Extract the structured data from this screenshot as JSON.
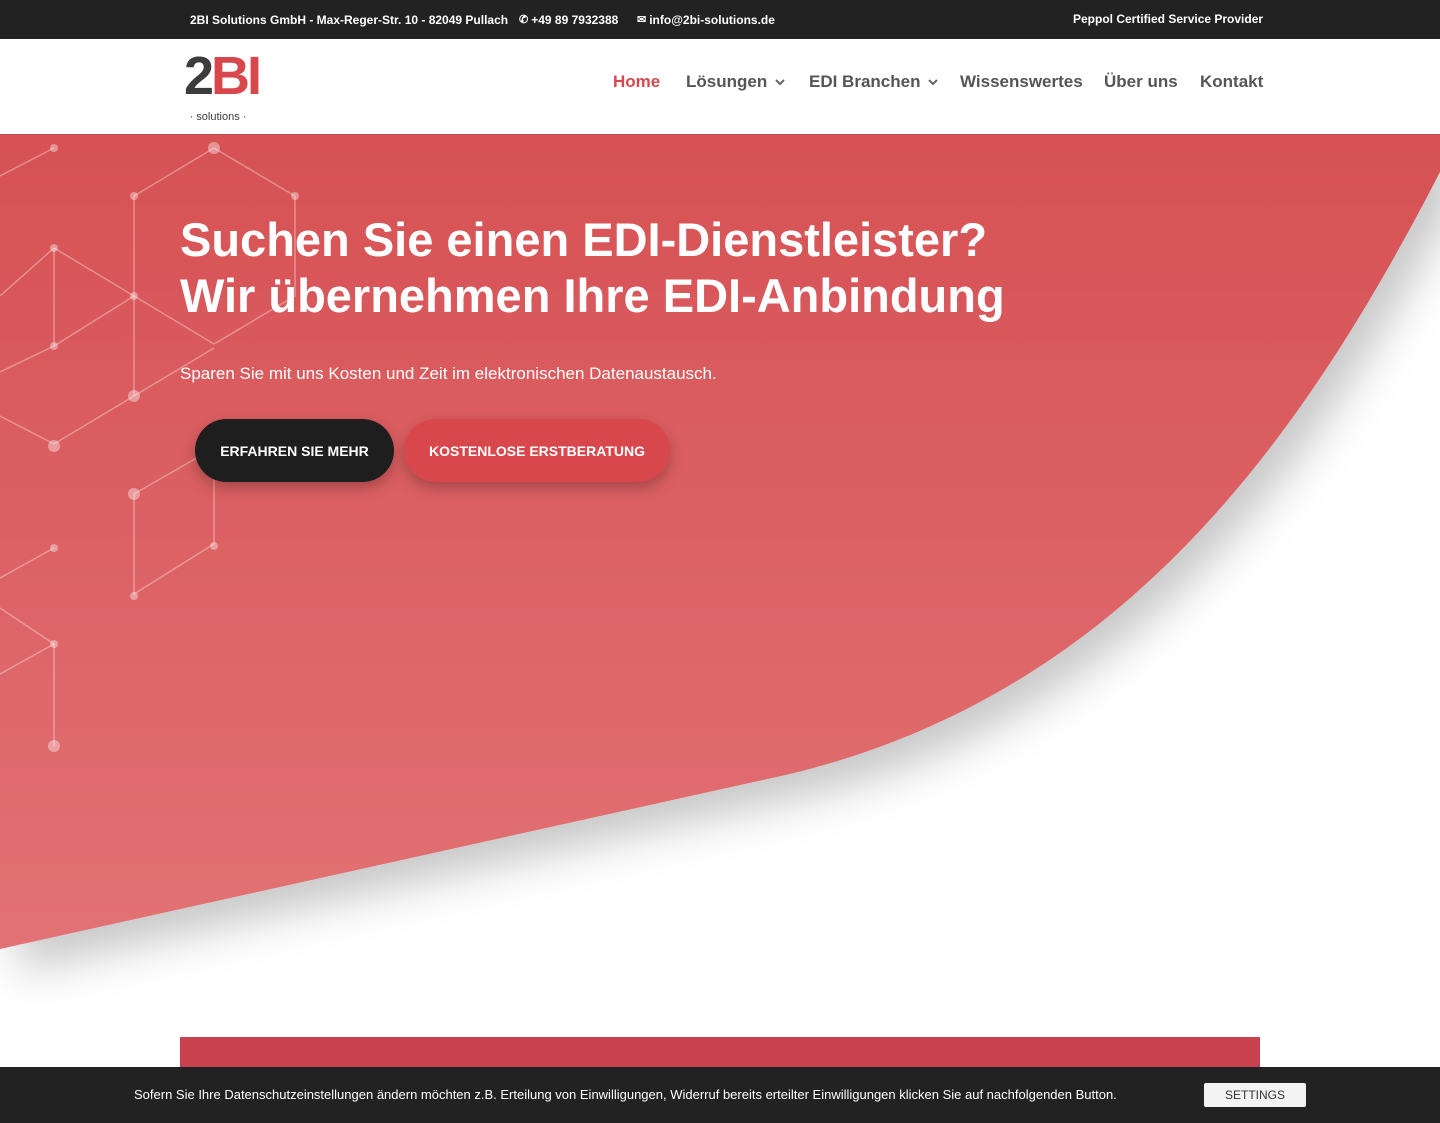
{
  "topbar": {
    "company": "2BI Solutions GmbH - Max-Reger-Str. 10 - 82049 Pullach",
    "phone": "+49 89 7932388",
    "email": "info@2bi-solutions.de",
    "peppol": "Peppol Certified Service Provider"
  },
  "logo": {
    "mark_two": "2",
    "mark_bi": "BI",
    "sub": "· solutions ·"
  },
  "nav": {
    "items": [
      {
        "label": "Home",
        "active": true,
        "has_dropdown": false
      },
      {
        "label": "Lösungen",
        "active": false,
        "has_dropdown": true
      },
      {
        "label": "EDI Branchen",
        "active": false,
        "has_dropdown": true
      },
      {
        "label": "Wissenswertes",
        "active": false,
        "has_dropdown": false
      },
      {
        "label": "Über uns",
        "active": false,
        "has_dropdown": false
      },
      {
        "label": "Kontakt",
        "active": false,
        "has_dropdown": false
      }
    ],
    "chevron_icon": "chevron-down-icon"
  },
  "hero": {
    "title_line1": "Suchen Sie einen EDI-Dienstleister?",
    "title_line2": "Wir übernehmen Ihre EDI-Anbindung",
    "lead": "Sparen Sie mit uns Kosten und Zeit im elektronischen Datenaustausch.",
    "btn_more": "Erfahren Sie mehr",
    "btn_consult": "Kostenlose Erstberatung"
  },
  "cookie": {
    "text": "Sofern Sie Ihre Datenschutzeinstellungen ändern möchten z.B. Erteilung von Einwilligungen, Widerruf bereits erteilter Einwilligungen klicken Sie auf nachfolgenden Button.",
    "button": "SETTINGS"
  },
  "colors": {
    "brand_red": "#d8474c",
    "dark": "#222222",
    "hero_gradient_top": "#d65154",
    "hero_gradient_bottom": "#e27274"
  },
  "icons": {
    "phone": "phone-icon",
    "email": "envelope-icon"
  }
}
